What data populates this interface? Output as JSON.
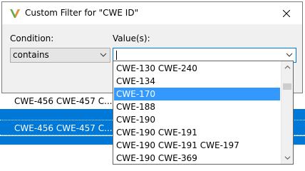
{
  "window": {
    "title": "Custom Filter for \"CWE ID\""
  },
  "form": {
    "condition_label": "Condition:",
    "condition_value": "contains",
    "values_label": "Value(s):",
    "values_input": ""
  },
  "dropdown": {
    "items": [
      "CWE-130 CWE-240",
      "CWE-134",
      "CWE-170",
      "CWE-188",
      "CWE-190",
      "CWE-190 CWE-191",
      "CWE-190 CWE-191 CWE-197",
      "CWE-190 CWE-369"
    ],
    "selected_index": 2
  },
  "background_rows": [
    "CWE-456 CWE-457 C...",
    "CWE-456 CWE-457 C..."
  ],
  "colors": {
    "selection": "#0078d7",
    "dropdown_selection": "#3399ff",
    "app_icon_green": "#6aa84f",
    "app_icon_orange": "#e69138"
  },
  "icons": {
    "app": "app-logo-icon",
    "close": "close-icon",
    "combo": "chevron-down-icon",
    "scroll_up": "chevron-up-icon",
    "scroll_down": "chevron-down-icon"
  }
}
